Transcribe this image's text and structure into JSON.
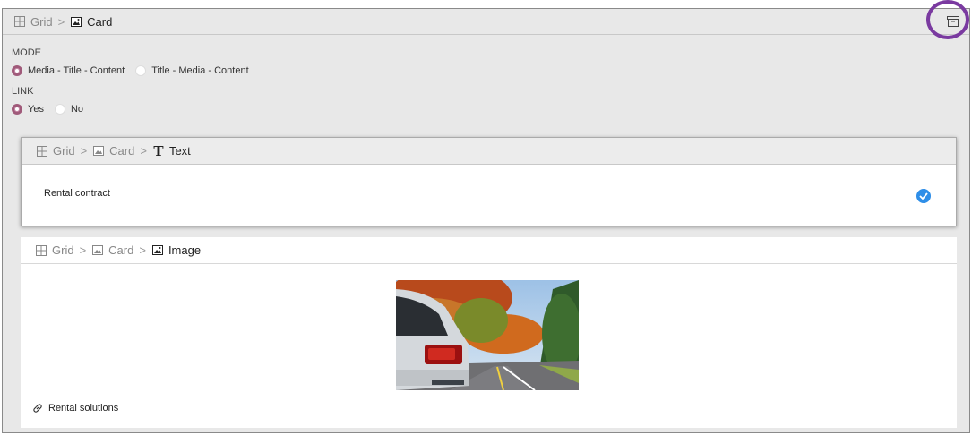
{
  "header": {
    "grid": "Grid",
    "sep": ">",
    "card": "Card"
  },
  "mode": {
    "label": "MODE",
    "options": [
      "Media - Title - Content",
      "Title - Media - Content"
    ],
    "selected": "Media - Title - Content"
  },
  "link": {
    "label": "LINK",
    "options": [
      "Yes",
      "No"
    ],
    "selected": "Yes"
  },
  "text_card": {
    "grid": "Grid",
    "card": "Card",
    "current": "Text",
    "value": "Rental contract"
  },
  "image_card": {
    "grid": "Grid",
    "card": "Card",
    "current": "Image",
    "link_text": "Rental solutions"
  },
  "colors": {
    "radio_accent": "#a05a7a",
    "check_blue": "#2e8ee8",
    "highlight_ring": "#7a3aa0"
  },
  "icons": [
    "grid-icon",
    "image-icon",
    "text-icon",
    "archive-icon",
    "check-icon",
    "link-icon"
  ]
}
